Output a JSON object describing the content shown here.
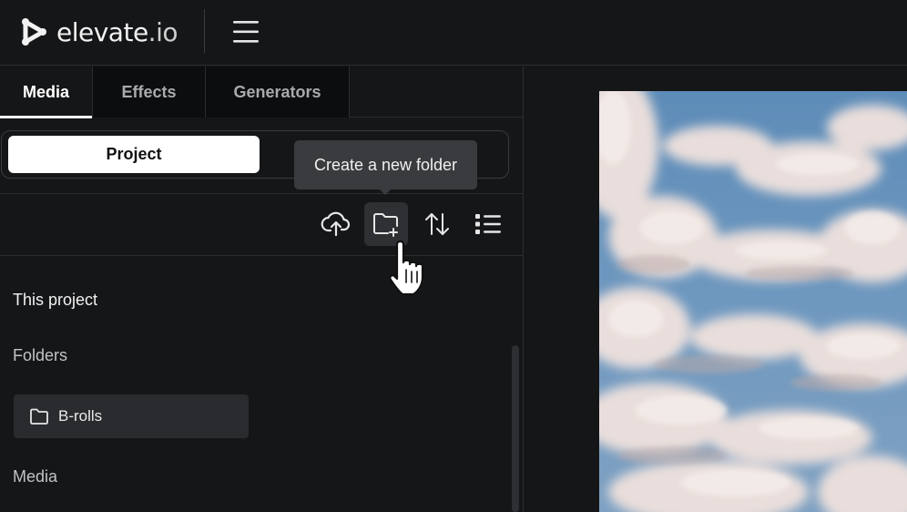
{
  "app": {
    "brand_main": "elevate",
    "brand_suffix": ".io"
  },
  "tabs": [
    {
      "label": "Media",
      "active": true
    },
    {
      "label": "Effects",
      "active": false
    },
    {
      "label": "Generators",
      "active": false
    }
  ],
  "segment": {
    "selected_label": "Project"
  },
  "tooltip": {
    "text": "Create a new folder"
  },
  "toolbar": {
    "icons": [
      "upload-cloud-icon",
      "new-folder-icon",
      "sort-icon",
      "list-view-icon"
    ]
  },
  "sections": {
    "this_project": "This project",
    "folders": "Folders",
    "media": "Media"
  },
  "folders": [
    {
      "name": "B-rolls"
    }
  ],
  "colors": {
    "background": "#151618",
    "panel_border": "#2c2d30",
    "tooltip_bg": "#3a3b3e",
    "selected_segment": "#ffffff",
    "folder_card": "#2a2b2e"
  }
}
